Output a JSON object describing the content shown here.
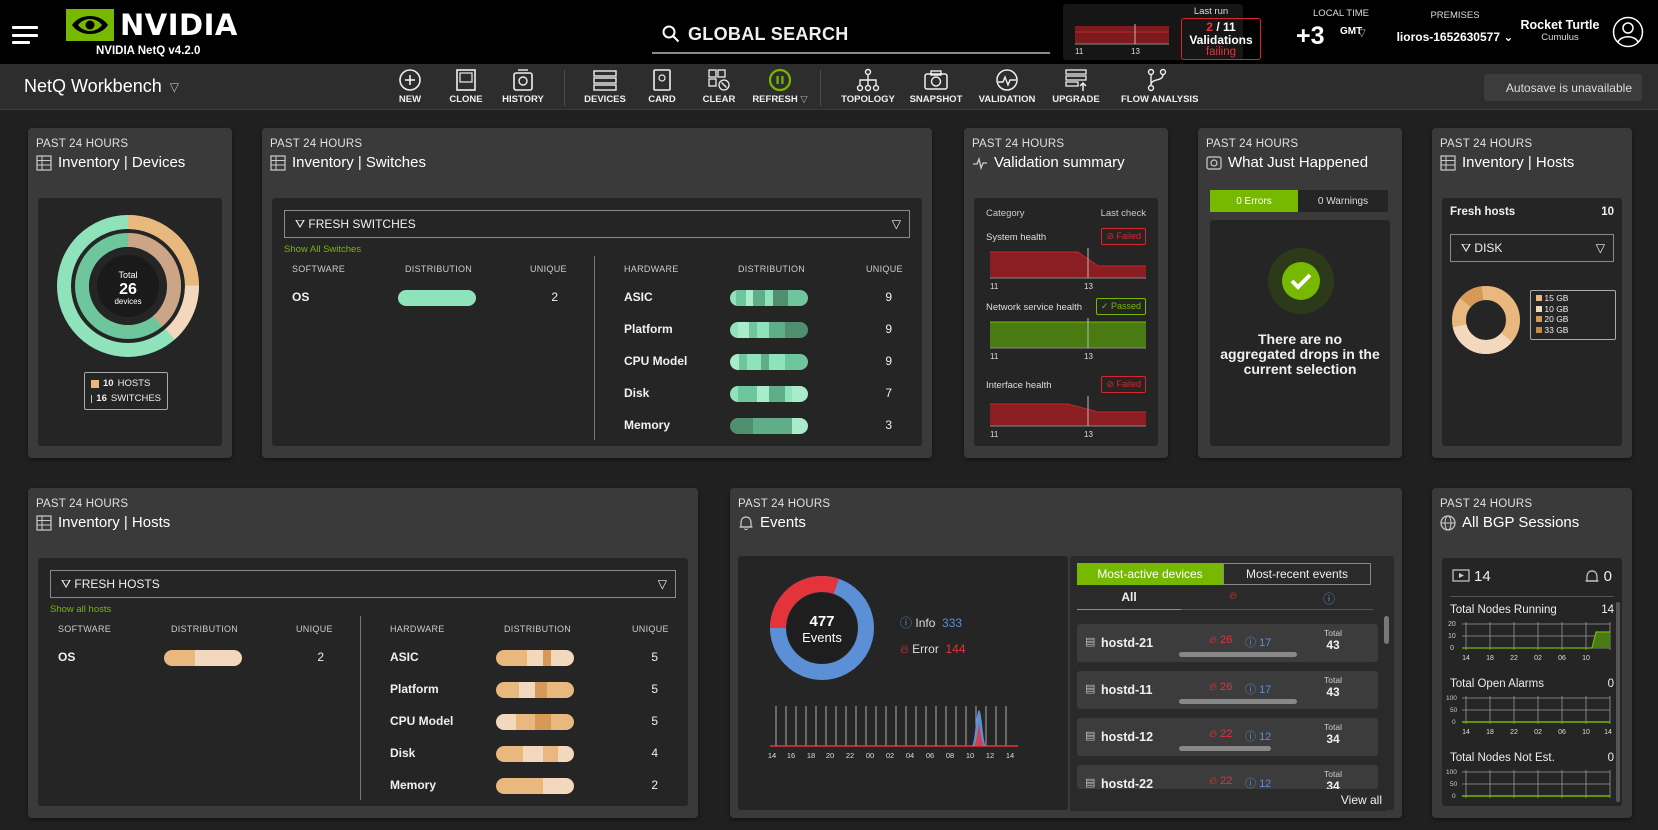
{
  "header": {
    "logo_text": "NVIDIA",
    "version": "NVIDIA NetQ v4.2.0",
    "search_placeholder": "GLOBAL SEARCH",
    "last_run": {
      "label": "Last run",
      "failing": "2",
      "total": "/ 11",
      "validations": "Validations",
      "status": "failing",
      "spark_ticks": [
        "11",
        "13"
      ]
    },
    "local_time": {
      "label": "LOCAL TIME",
      "offset": "+3",
      "suffix": "GMT"
    },
    "premises": {
      "label": "PREMISES",
      "value": "lioros-1652630577"
    },
    "user": {
      "name": "Rocket Turtle",
      "org": "Cumulus"
    }
  },
  "toolbar": {
    "workbench_title": "NetQ Workbench",
    "items": [
      {
        "label": "NEW",
        "icon": "plus-circle-icon"
      },
      {
        "label": "CLONE",
        "icon": "clone-icon"
      },
      {
        "label": "HISTORY",
        "icon": "history-icon"
      },
      {
        "label": "DEVICES",
        "icon": "devices-icon"
      },
      {
        "label": "CARD",
        "icon": "card-icon"
      },
      {
        "label": "CLEAR",
        "icon": "clear-icon"
      },
      {
        "label": "REFRESH",
        "icon": "refresh-icon"
      },
      {
        "label": "TOPOLOGY",
        "icon": "topology-icon"
      },
      {
        "label": "SNAPSHOT",
        "icon": "camera-icon"
      },
      {
        "label": "VALIDATION",
        "icon": "validation-icon"
      },
      {
        "label": "UPGRADE",
        "icon": "upgrade-icon"
      },
      {
        "label": "FLOW ANALYSIS",
        "icon": "flow-analysis-icon"
      }
    ],
    "autosave": "Autosave is unavailable"
  },
  "cards": {
    "inv_devices": {
      "past": "PAST 24 HOURS",
      "title": "Inventory | Devices",
      "total_label": "Total",
      "total": "26",
      "unit": "devices",
      "legend": [
        {
          "count": "10",
          "label": "HOSTS",
          "color": "#e8b87e"
        },
        {
          "count": "16",
          "label": "SWITCHES",
          "color": "#8fe3bb"
        }
      ]
    },
    "inv_switches": {
      "past": "PAST 24 HOURS",
      "title": "Inventory | Switches",
      "filter": "FRESH SWITCHES",
      "show_all": "Show All Switches",
      "sw_cols": [
        "SOFTWARE",
        "DISTRIBUTION",
        "UNIQUE"
      ],
      "hw_cols": [
        "HARDWARE",
        "DISTRIBUTION",
        "UNIQUE"
      ],
      "software": [
        {
          "label": "OS",
          "unique": "2"
        }
      ],
      "hardware": [
        {
          "label": "ASIC",
          "unique": "9"
        },
        {
          "label": "Platform",
          "unique": "9"
        },
        {
          "label": "CPU Model",
          "unique": "9"
        },
        {
          "label": "Disk",
          "unique": "7"
        },
        {
          "label": "Memory",
          "unique": "3"
        }
      ]
    },
    "validation": {
      "past": "PAST 24 HOURS",
      "title": "Validation summary",
      "col_category": "Category",
      "col_last": "Last check",
      "rows": [
        {
          "name": "System health",
          "status": "Failed"
        },
        {
          "name": "Network service health",
          "status": "Passed"
        },
        {
          "name": "Interface health",
          "status": "Failed"
        }
      ],
      "ticks": [
        "11",
        "13"
      ]
    },
    "wjh": {
      "past": "PAST 24 HOURS",
      "title": "What Just Happened",
      "tab_errors": "0 Errors",
      "tab_warnings": "0 Warnings",
      "message": "There are no aggregated drops in the current selection"
    },
    "inv_hosts_small": {
      "past": "PAST 24 HOURS",
      "title": "Inventory | Hosts",
      "fresh_label": "Fresh hosts",
      "fresh_count": "10",
      "filter": "DISK",
      "legend": [
        "15 GB",
        "10 GB",
        "20 GB",
        "33 GB"
      ]
    },
    "inv_hosts": {
      "past": "PAST 24 HOURS",
      "title": "Inventory | Hosts",
      "filter": "FRESH HOSTS",
      "show_all": "Show all hosts",
      "sw_cols": [
        "SOFTWARE",
        "DISTRIBUTION",
        "UNIQUE"
      ],
      "hw_cols": [
        "HARDWARE",
        "DISTRIBUTION",
        "UNIQUE"
      ],
      "software": [
        {
          "label": "OS",
          "unique": "2"
        }
      ],
      "hardware": [
        {
          "label": "ASIC",
          "unique": "5"
        },
        {
          "label": "Platform",
          "unique": "5"
        },
        {
          "label": "CPU Model",
          "unique": "5"
        },
        {
          "label": "Disk",
          "unique": "4"
        },
        {
          "label": "Memory",
          "unique": "2"
        }
      ]
    },
    "events": {
      "past": "PAST 24 HOURS",
      "title": "Events",
      "total": "477",
      "unit": "Events",
      "info_label": "Info",
      "info_count": "333",
      "error_label": "Error",
      "error_count": "144",
      "x_ticks": [
        "14",
        "16",
        "18",
        "20",
        "22",
        "00",
        "02",
        "04",
        "06",
        "08",
        "10",
        "12",
        "14"
      ],
      "tab_active": "Most-active devices",
      "tab_recent": "Most-recent events",
      "subtab_all": "All",
      "total_word": "Total",
      "devices": [
        {
          "name": "hostd-21",
          "errors": "26",
          "info": "17",
          "total": "43"
        },
        {
          "name": "hostd-11",
          "errors": "26",
          "info": "17",
          "total": "43"
        },
        {
          "name": "hostd-12",
          "errors": "22",
          "info": "12",
          "total": "34"
        },
        {
          "name": "hostd-22",
          "errors": "22",
          "info": "12",
          "total": "34"
        }
      ],
      "view_all": "View all"
    },
    "bgp": {
      "past": "PAST 24 HOURS",
      "title": "All BGP Sessions",
      "sessions": "14",
      "alarms": "0",
      "metrics": [
        {
          "label": "Total Nodes Running",
          "value": "14",
          "y_ticks": [
            "20",
            "10",
            "0"
          ]
        },
        {
          "label": "Total Open Alarms",
          "value": "0",
          "y_ticks": [
            "100",
            "50",
            "0"
          ]
        },
        {
          "label": "Total Nodes Not Est.",
          "value": "0",
          "y_ticks": [
            "100",
            "50",
            "0"
          ]
        }
      ],
      "x_ticks": [
        "14",
        "18",
        "22",
        "02",
        "06",
        "10",
        "14"
      ]
    }
  }
}
